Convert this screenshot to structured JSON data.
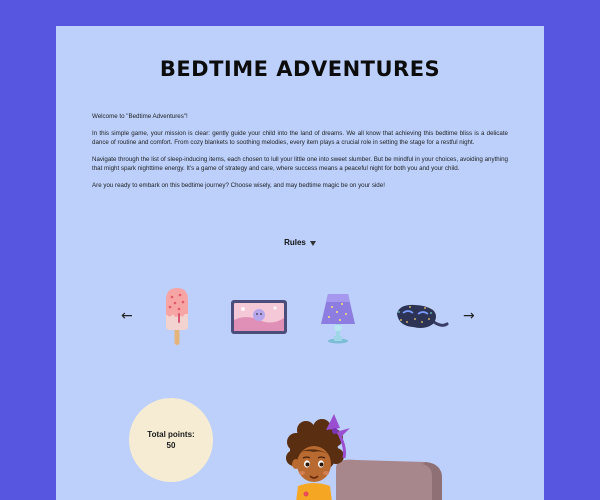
{
  "game": {
    "title": "BEDTIME ADVENTURES",
    "intro": [
      "Welcome to \"Bedtime Adventures\"!",
      "In this simple game, your mission is clear: gently guide your child into the land of dreams. We all know that achieving this bedtime bliss is a delicate dance of routine and comfort. From cozy blankets to soothing melodies, every item plays a crucial role in setting the stage for a restful night.",
      "Navigate through the list of sleep-inducing items, each chosen to lull your little one into sweet slumber. But be mindful in your choices, avoiding anything that might spark nighttime energy. It's a game of strategy and care, where success means a peaceful night for both you and your child.",
      "Are you ready to embark on this bedtime journey? Choose wisely, and may bedtime magic be on your side!"
    ],
    "rules_label": "Rules",
    "carousel": {
      "prev_arrow": "←",
      "next_arrow": "→",
      "items": [
        {
          "name": "popsicle-icon"
        },
        {
          "name": "tablet-icon"
        },
        {
          "name": "lamp-icon"
        },
        {
          "name": "sleep-mask-icon"
        }
      ]
    },
    "score": {
      "label": "Total points:",
      "value": "50"
    }
  },
  "colors": {
    "background": "#5656e0",
    "panel": "#bcd0fb",
    "score_circle": "#f5ecd3"
  }
}
